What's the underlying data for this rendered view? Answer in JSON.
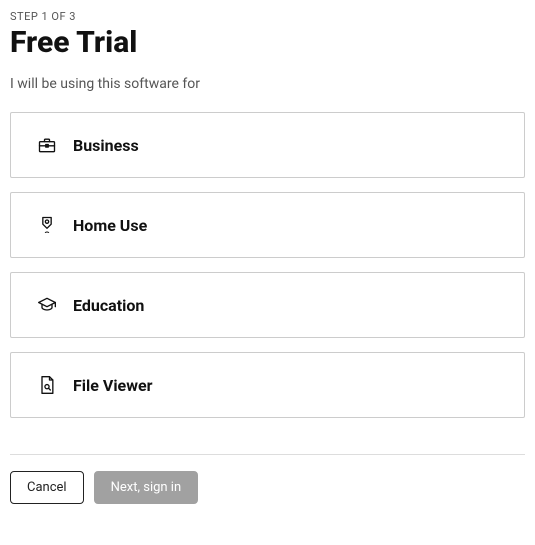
{
  "step_label": "STEP 1 OF 3",
  "title": "Free Trial",
  "prompt": "I will be using this software for",
  "options": [
    {
      "icon": "briefcase-icon",
      "label": "Business"
    },
    {
      "icon": "home-badge-icon",
      "label": "Home Use"
    },
    {
      "icon": "graduation-cap-icon",
      "label": "Education"
    },
    {
      "icon": "file-viewer-icon",
      "label": "File Viewer"
    }
  ],
  "buttons": {
    "cancel": "Cancel",
    "next": "Next, sign in"
  }
}
